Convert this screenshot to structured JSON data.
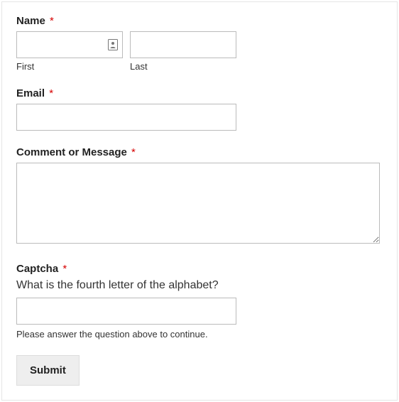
{
  "name": {
    "label": "Name",
    "first_sub": "First",
    "last_sub": "Last"
  },
  "email": {
    "label": "Email"
  },
  "comment": {
    "label": "Comment or Message"
  },
  "captcha": {
    "label": "Captcha",
    "question": "What is the fourth letter of the alphabet?",
    "hint": "Please answer the question above to continue."
  },
  "submit": {
    "label": "Submit"
  },
  "required_mark": "*"
}
